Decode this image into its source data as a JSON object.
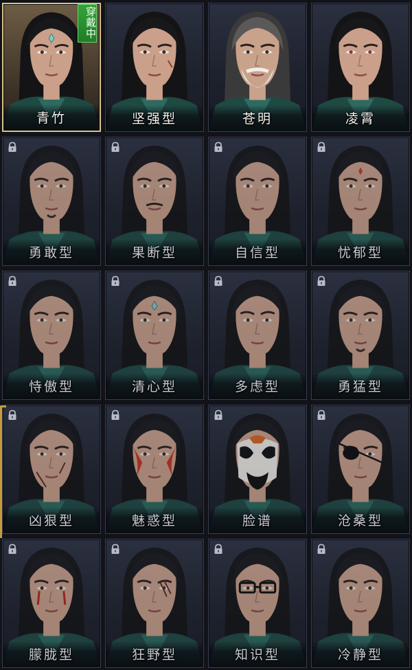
{
  "equipped_badge": "穿戴中",
  "colors": {
    "equipped_border": "#d8c38a",
    "badge_green": "#2a9030",
    "lock": "#b8bcc8"
  },
  "cards": [
    {
      "name": "青竹",
      "locked": false,
      "equipped": true,
      "face": "young-forehead-gem"
    },
    {
      "name": "坚强型",
      "locked": false,
      "equipped": false,
      "face": "scar"
    },
    {
      "name": "苍明",
      "locked": false,
      "equipped": false,
      "face": "old-white-beard"
    },
    {
      "name": "凌霄",
      "locked": false,
      "equipped": false,
      "face": "young-pink-eyes"
    },
    {
      "name": "勇敢型",
      "locked": true,
      "equipped": false,
      "face": "stubble"
    },
    {
      "name": "果断型",
      "locked": true,
      "equipped": false,
      "face": "mustache"
    },
    {
      "name": "自信型",
      "locked": true,
      "equipped": false,
      "face": "plain"
    },
    {
      "name": "忧郁型",
      "locked": true,
      "equipped": false,
      "face": "forehead-mark"
    },
    {
      "name": "恃傲型",
      "locked": true,
      "equipped": false,
      "face": "plain"
    },
    {
      "name": "清心型",
      "locked": true,
      "equipped": false,
      "face": "forehead-gem"
    },
    {
      "name": "多虑型",
      "locked": true,
      "equipped": false,
      "face": "frown"
    },
    {
      "name": "勇猛型",
      "locked": true,
      "equipped": false,
      "face": "goatee"
    },
    {
      "name": "凶狠型",
      "locked": true,
      "equipped": false,
      "face": "cheek-scar"
    },
    {
      "name": "魅惑型",
      "locked": true,
      "equipped": false,
      "face": "red-paint"
    },
    {
      "name": "脸谱",
      "locked": true,
      "equipped": false,
      "face": "opera-mask"
    },
    {
      "name": "沧桑型",
      "locked": true,
      "equipped": false,
      "face": "eyepatch"
    },
    {
      "name": "朦胧型",
      "locked": true,
      "equipped": false,
      "face": "red-tears"
    },
    {
      "name": "狂野型",
      "locked": true,
      "equipped": false,
      "face": "claw-scar"
    },
    {
      "name": "知识型",
      "locked": true,
      "equipped": false,
      "face": "glasses"
    },
    {
      "name": "冷静型",
      "locked": true,
      "equipped": false,
      "face": "plain"
    }
  ]
}
